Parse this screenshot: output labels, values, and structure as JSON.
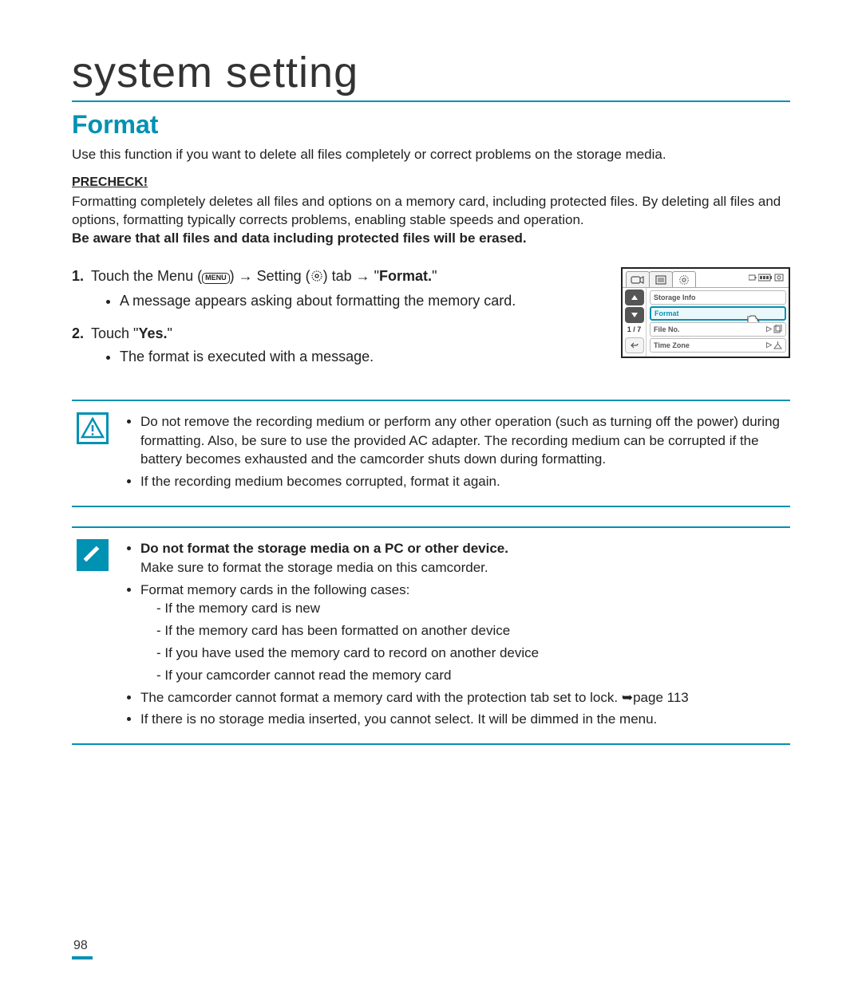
{
  "page": {
    "title": "system setting",
    "section": "Format",
    "intro": "Use this function if you want to delete all files completely or correct problems on the storage media.",
    "number": "98"
  },
  "precheck": {
    "label": "PRECHECK!",
    "text": "Formatting completely deletes all files and options on a memory card, including protected files. By deleting all files and options, formatting typically corrects problems, enabling stable speeds and operation.",
    "warning": "Be aware that all files and data including protected files will be erased."
  },
  "steps": {
    "s1_a": "Touch the Menu (",
    "s1_b": ") ",
    "s1_c": " Setting (",
    "s1_d": ") tab ",
    "s1_e": " \"",
    "s1_f": "Format.",
    "s1_g": "\"",
    "s1_bullet": "A message appears asking about formatting the memory card.",
    "s2_a": "Touch \"",
    "s2_b": "Yes.",
    "s2_c": "\"",
    "s2_bullet": "The format is executed with a message.",
    "menu_label": "MENU"
  },
  "mini_ui": {
    "page_indicator": "1 / 7",
    "items": {
      "storage_info": "Storage Info",
      "format": "Format",
      "file_no": "File No.",
      "time_zone": "Time Zone"
    }
  },
  "warning_callout": {
    "b1": "Do not remove the recording medium or perform any other operation (such as turning off the power) during formatting. Also, be sure to use the provided AC adapter. The recording medium can be corrupted if the battery becomes exhausted and the camcorder shuts down during formatting.",
    "b2": "If the recording medium becomes corrupted, format it again."
  },
  "note_callout": {
    "b1_bold": "Do not format the storage media on a PC or other device.",
    "b1_sub": "Make sure to format the storage media on this camcorder.",
    "b2": "Format memory cards in the following cases:",
    "b2_cases": {
      "c1": "If the memory card is new",
      "c2": "If the memory card has been formatted on another device",
      "c3": "If you have used the memory card to record on another device",
      "c4": "If your camcorder cannot read the memory card"
    },
    "b3_a": "The camcorder cannot format a memory card with the protection tab set to lock. ",
    "b3_b": "page 113",
    "b4": "If there is no storage media inserted, you cannot select. It will be dimmed in the menu."
  }
}
